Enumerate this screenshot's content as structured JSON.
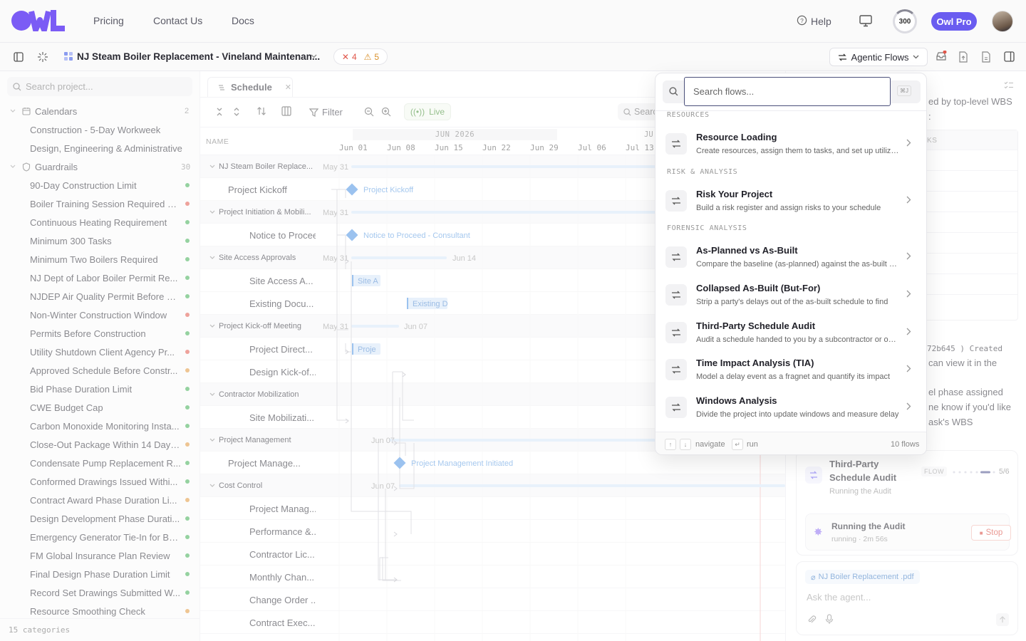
{
  "nav": {
    "links": [
      "Pricing",
      "Contact Us",
      "Docs"
    ],
    "help": "Help",
    "credits": "300",
    "pro": "Owl Pro"
  },
  "project": {
    "title": "NJ Steam Boiler Replacement - Vineland Maintenan...",
    "errors": "4",
    "warnings": "5",
    "agentic": "Agentic Flows"
  },
  "sidebar": {
    "search_placeholder": "Search project...",
    "calendars": {
      "label": "Calendars",
      "count": "2",
      "items": [
        "Construction - 5-Day Workweek",
        "Design, Engineering & Administrative"
      ]
    },
    "guardrails": {
      "label": "Guardrails",
      "count": "30",
      "items": [
        {
          "label": "90-Day Construction Limit",
          "status": "#3fae52"
        },
        {
          "label": "Boiler Training Session Required B...",
          "status": "#e0564a"
        },
        {
          "label": "Continuous Heating Requirement",
          "status": "#3fae52"
        },
        {
          "label": "Minimum 300 Tasks",
          "status": "#3fae52"
        },
        {
          "label": "Minimum Two Boilers Required",
          "status": "#3fae52"
        },
        {
          "label": "NJ Dept of Labor Boiler Permit Re...",
          "status": "#3fae52"
        },
        {
          "label": "NJDEP Air Quality Permit Before C...",
          "status": "#3fae52"
        },
        {
          "label": "Non-Winter Construction Window",
          "status": "#e0564a"
        },
        {
          "label": "Permits Before Construction",
          "status": "#3fae52"
        },
        {
          "label": "Utility Shutdown Client Agency Pr...",
          "status": "#e0564a"
        },
        {
          "label": "Approved Schedule Before Constr...",
          "status": "#e0963a"
        },
        {
          "label": "Bid Phase Duration Limit",
          "status": "#3fae52"
        },
        {
          "label": "CWE Budget Cap",
          "status": "#3fae52"
        },
        {
          "label": "Carbon Monoxide Monitoring Insta...",
          "status": "#3fae52"
        },
        {
          "label": "Close-Out Package Within 14 Days...",
          "status": "#e0963a"
        },
        {
          "label": "Condensate Pump Replacement R...",
          "status": "#3fae52"
        },
        {
          "label": "Conformed Drawings Issued Withi...",
          "status": "#3fae52"
        },
        {
          "label": "Contract Award Phase Duration Li...",
          "status": "#e0963a"
        },
        {
          "label": "Design Development Phase Durati...",
          "status": "#3fae52"
        },
        {
          "label": "Emergency Generator Tie-In for Bo...",
          "status": "#3fae52"
        },
        {
          "label": "FM Global Insurance Plan Review",
          "status": "#3fae52"
        },
        {
          "label": "Final Design Phase Duration Limit",
          "status": "#3fae52"
        },
        {
          "label": "Record Set Drawings Submitted W...",
          "status": "#3fae52"
        },
        {
          "label": "Resource Smoothing Check",
          "status": "#e0963a"
        }
      ]
    },
    "footer": "15 categories"
  },
  "gantt": {
    "tab": "Schedule",
    "filter": "Filter",
    "live": "Live",
    "search": "Search",
    "name_header": "NAME",
    "month": "JUN 2026",
    "month2": "JU",
    "weeks": [
      "Jun 01",
      "Jun 08",
      "Jun 15",
      "Jun 22",
      "Jun 29",
      "Jul 06",
      "Jul 13"
    ],
    "rows": [
      {
        "name": "NJ Steam Boiler Replace...",
        "group": true,
        "level": 0,
        "date": "May 31"
      },
      {
        "name": "Project Kickoff",
        "group": false,
        "level": 1,
        "label": "Project Kickoff"
      },
      {
        "name": "Project Initiation & Mobili...",
        "group": true,
        "level": 0,
        "date": "May 31"
      },
      {
        "name": "Notice to Procee...",
        "group": false,
        "level": 2,
        "label": "Notice to Proceed - Consultant"
      },
      {
        "name": "Site Access Approvals",
        "group": true,
        "level": 0,
        "date": "May 31",
        "date2": "Jun 14"
      },
      {
        "name": "Site Access A...",
        "group": false,
        "level": 2,
        "label": "Site A"
      },
      {
        "name": "Existing Docu...",
        "group": false,
        "level": 2,
        "label": "Existing D"
      },
      {
        "name": "Project Kick-off Meeting",
        "group": true,
        "level": 0,
        "date": "May 31",
        "date2": "Jun 07"
      },
      {
        "name": "Project Direct...",
        "group": false,
        "level": 2,
        "label": "Proje"
      },
      {
        "name": "Design Kick-of...",
        "group": false,
        "level": 2
      },
      {
        "name": "Contractor Mobilization",
        "group": true,
        "level": 0
      },
      {
        "name": "Site Mobilizati...",
        "group": false,
        "level": 2
      },
      {
        "name": "Project Management",
        "group": true,
        "level": 0,
        "date": "Jun 07"
      },
      {
        "name": "Project Manage...",
        "group": false,
        "level": 1,
        "label": "Project Management Initiated"
      },
      {
        "name": "Cost Control",
        "group": true,
        "level": 0,
        "date": "Jun 07"
      },
      {
        "name": "Project Manag...",
        "group": false,
        "level": 2
      },
      {
        "name": "Performance &...",
        "group": false,
        "level": 2
      },
      {
        "name": "Contractor Lic...",
        "group": false,
        "level": 2
      },
      {
        "name": "Monthly Chan...",
        "group": false,
        "level": 2
      },
      {
        "name": "Change Order ...",
        "group": false,
        "level": 2
      },
      {
        "name": "Contract Exec...",
        "group": false,
        "level": 2
      }
    ]
  },
  "right_panel": {
    "lines_top": [
      "ed by top-level WBS",
      ":"
    ],
    "table_header": "KS",
    "lines_mid": [
      "72b645 ) Created",
      "can view it in the"
    ],
    "lines_low": [
      "el phase assigned",
      "ne know if you'd like",
      "ask's WBS"
    ],
    "flow": {
      "title1": "Third-Party",
      "title2": "Schedule Audit",
      "tag": "FLOW",
      "step": "5/6",
      "subtitle": "Running the Audit",
      "run_title": "Running the Audit",
      "run_status": "running · 2m 56s",
      "stop": "Stop"
    },
    "composer": {
      "attachment": "NJ Boiler Replacement .pdf",
      "placeholder": "Ask the agent..."
    }
  },
  "flows_popup": {
    "search_placeholder": "Search flows...",
    "shortcut": "⌘J",
    "sections": [
      {
        "title": "RESOURCES",
        "items": [
          {
            "title": "Resource Loading",
            "desc": "Create resources, assign them to tasks, and set up utilization"
          }
        ]
      },
      {
        "title": "RISK & ANALYSIS",
        "items": [
          {
            "title": "Risk Your Project",
            "desc": "Build a risk register and assign risks to your schedule"
          }
        ]
      },
      {
        "title": "FORENSIC ANALYSIS",
        "items": [
          {
            "title": "As-Planned vs As-Built",
            "desc": "Compare the baseline (as-planned) against the as-built schedule"
          },
          {
            "title": "Collapsed As-Built (But-For)",
            "desc": "Strip a party's delays out of the as-built schedule to find"
          },
          {
            "title": "Third-Party Schedule Audit",
            "desc": "Audit a schedule handed to you by a subcontractor or owner"
          },
          {
            "title": "Time Impact Analysis (TIA)",
            "desc": "Model a delay event as a fragnet and quantify its impact"
          },
          {
            "title": "Windows Analysis",
            "desc": "Divide the project into update windows and measure delay"
          }
        ]
      }
    ],
    "footer": {
      "navigate": "navigate",
      "run": "run",
      "count": "10 flows"
    }
  },
  "colors": {
    "accent": "#6a5cf0",
    "bar": "#d6e6f7",
    "milestone": "#4a90e2"
  }
}
